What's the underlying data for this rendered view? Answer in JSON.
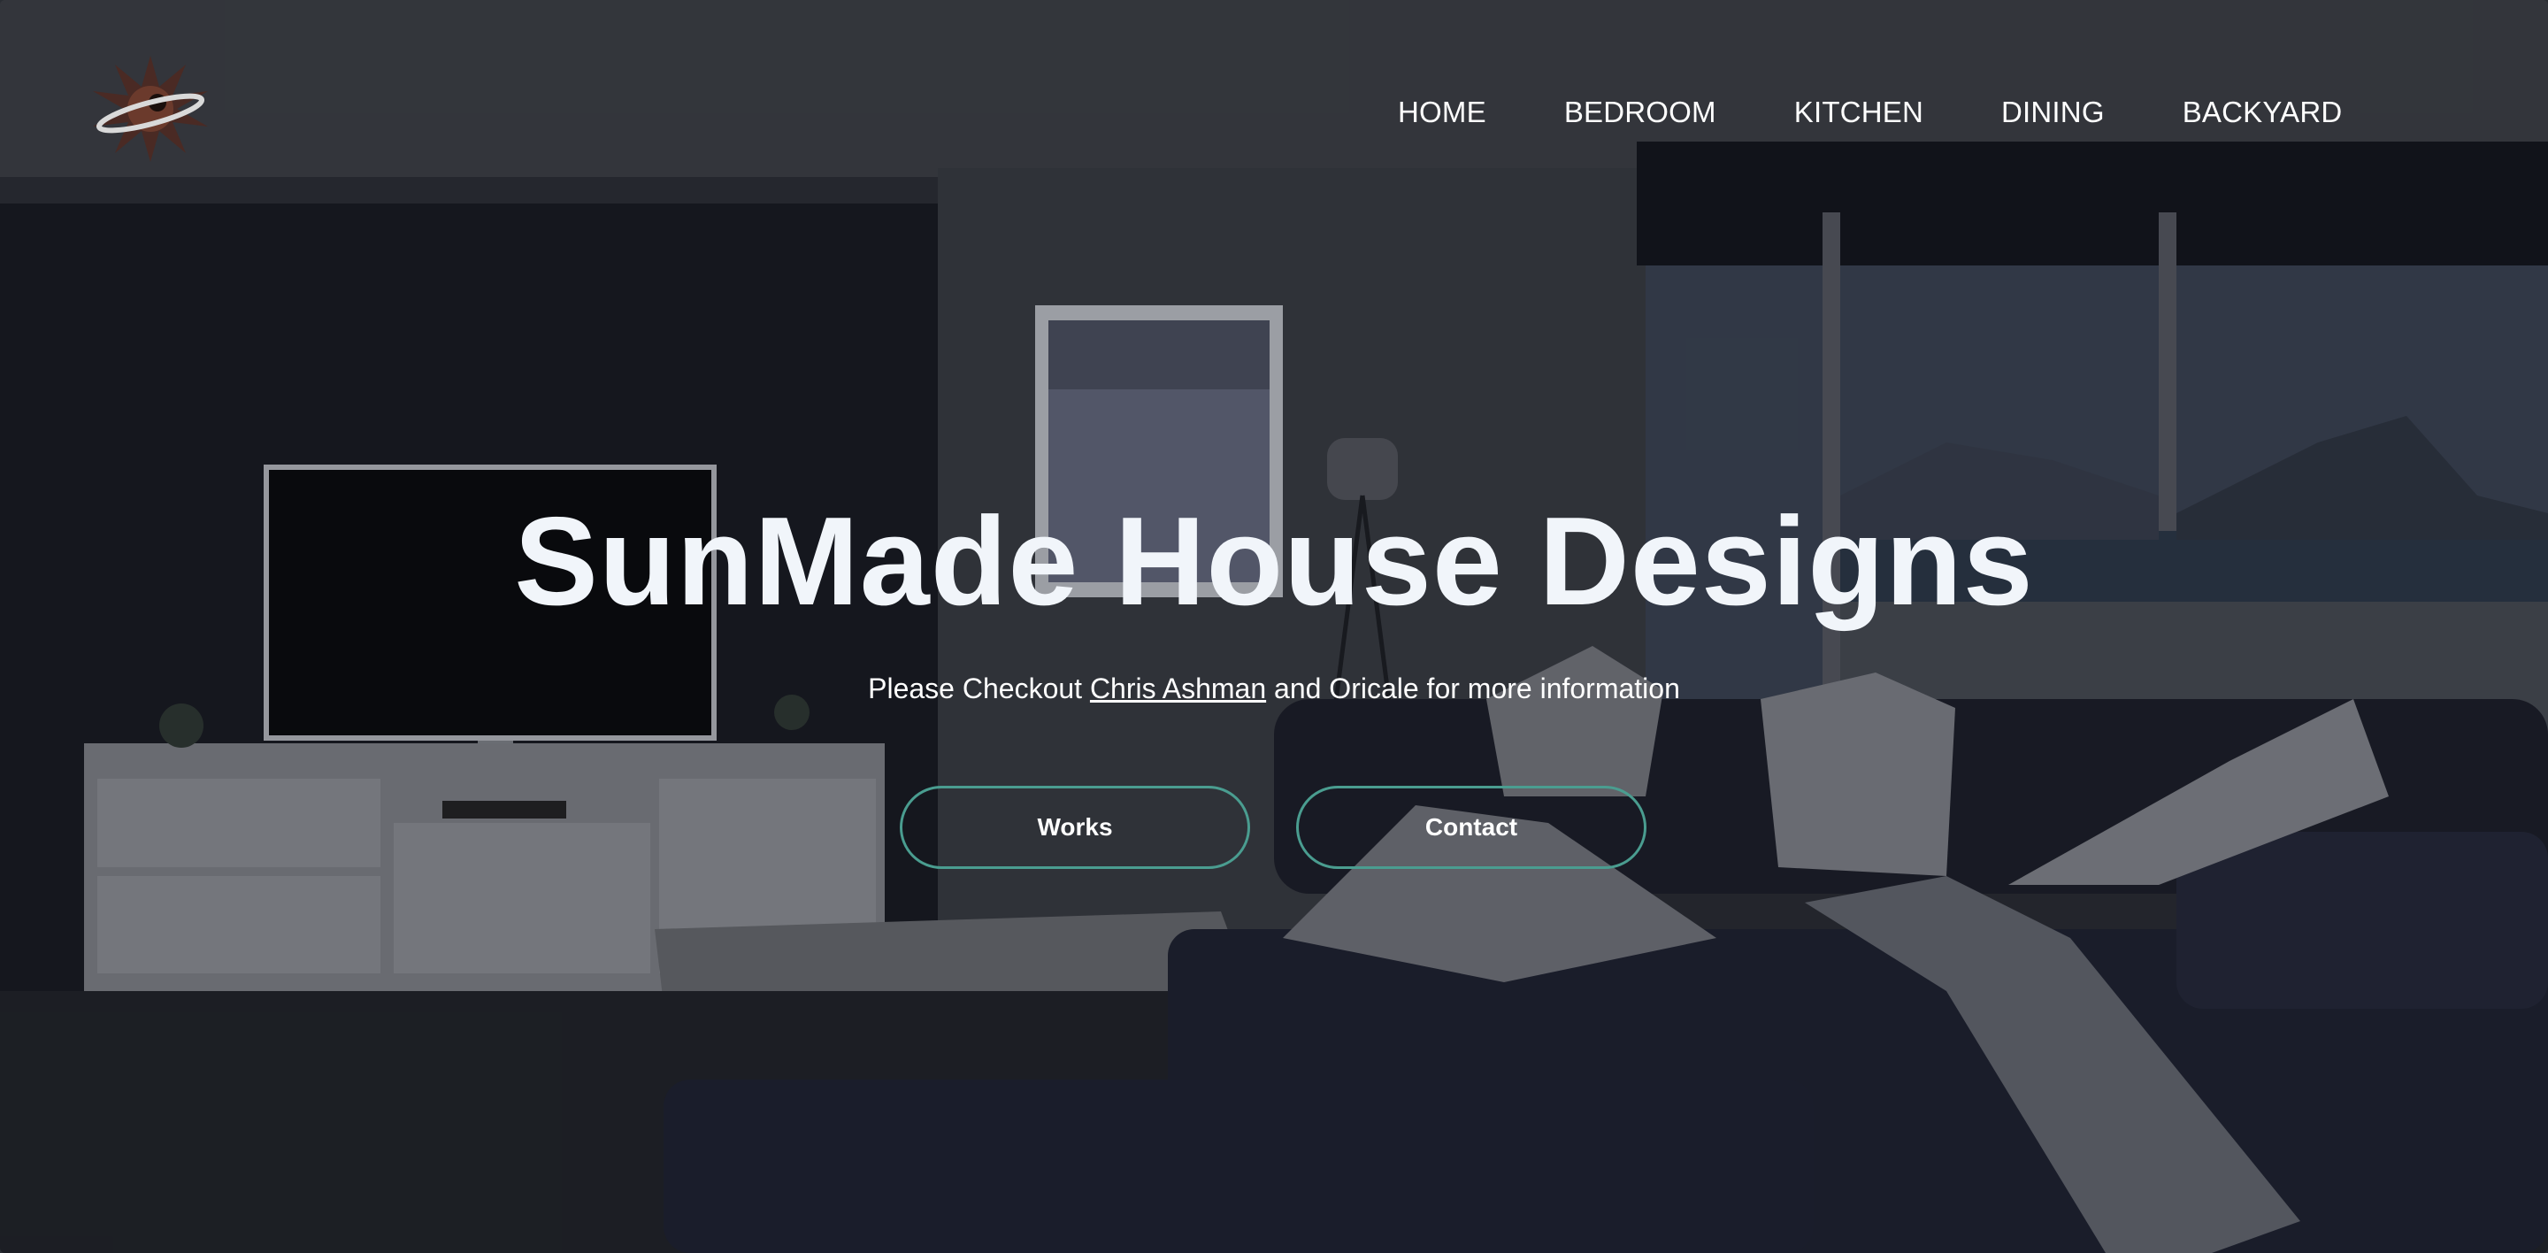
{
  "brand": {
    "logo_icon": "sun-logo-icon"
  },
  "nav": {
    "items": [
      {
        "label": "HOME"
      },
      {
        "label": "BEDROOM"
      },
      {
        "label": "KITCHEN"
      },
      {
        "label": "DINING"
      },
      {
        "label": "BACKYARD"
      }
    ]
  },
  "hero": {
    "title": "SunMade House Designs",
    "subtitle_prefix": "Please Checkout ",
    "subtitle_link": "Chris Ashman",
    "subtitle_suffix": " and Oricale for more information",
    "buttons": {
      "works": "Works",
      "contact": "Contact"
    }
  },
  "colors": {
    "button_border": "#4a9d90",
    "title": "#f1f5fa",
    "text": "#ffffff"
  }
}
